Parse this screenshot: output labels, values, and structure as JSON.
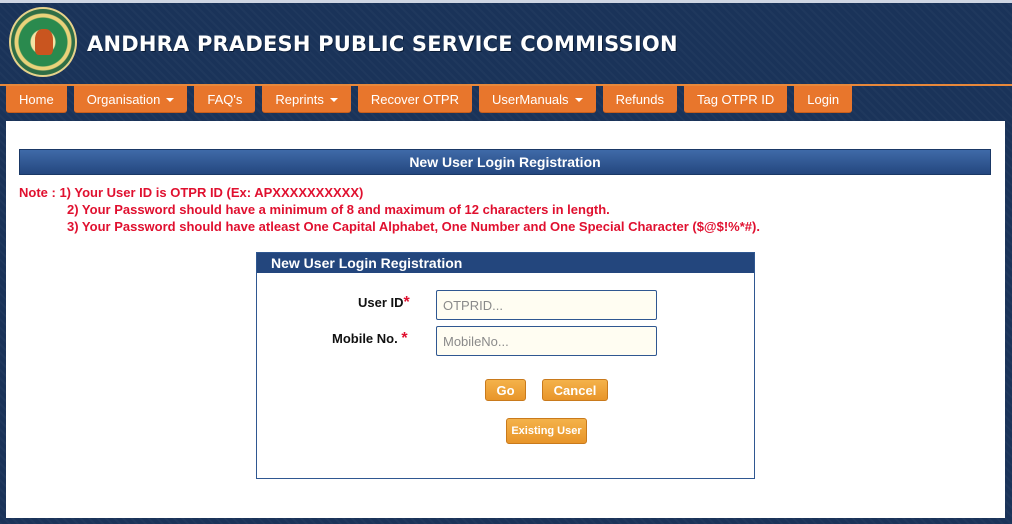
{
  "header": {
    "title": "ANDHRA PRADESH PUBLIC SERVICE COMMISSION",
    "logo_icon": "apspsc-emblem-icon"
  },
  "nav": {
    "items": [
      {
        "label": "Home",
        "dropdown": false
      },
      {
        "label": "Organisation",
        "dropdown": true
      },
      {
        "label": "FAQ's",
        "dropdown": false
      },
      {
        "label": "Reprints",
        "dropdown": true
      },
      {
        "label": "Recover OTPR",
        "dropdown": false
      },
      {
        "label": "UserManuals",
        "dropdown": true
      },
      {
        "label": "Refunds",
        "dropdown": false
      },
      {
        "label": "Tag OTPR ID",
        "dropdown": false
      },
      {
        "label": "Login",
        "dropdown": false
      }
    ]
  },
  "page": {
    "title": "New User Login Registration",
    "notes": [
      "Note : 1) Your User ID is OTPR ID (Ex: APXXXXXXXXXX)",
      "2) Your Password should have a minimum of 8 and maximum of 12 characters in length.",
      "3) Your Password should have atleast One Capital Alphabet, One Number and One Special Character ($@$!%*#)."
    ]
  },
  "form": {
    "panel_title": "New User Login Registration",
    "user_id": {
      "label": "User ID",
      "required_mark": "*",
      "placeholder": "OTPRID...",
      "value": ""
    },
    "mobile": {
      "label": "Mobile No.",
      "required_mark": "*",
      "placeholder": "MobileNo...",
      "value": ""
    },
    "go_label": "Go",
    "cancel_label": "Cancel",
    "existing_user_label": "Existing User"
  },
  "colors": {
    "header_bg": "#1a3359",
    "nav_orange": "#e8762c",
    "title_bar_blue": "#24477f",
    "note_red": "#e0102f",
    "button_orange": "#e8952a"
  }
}
